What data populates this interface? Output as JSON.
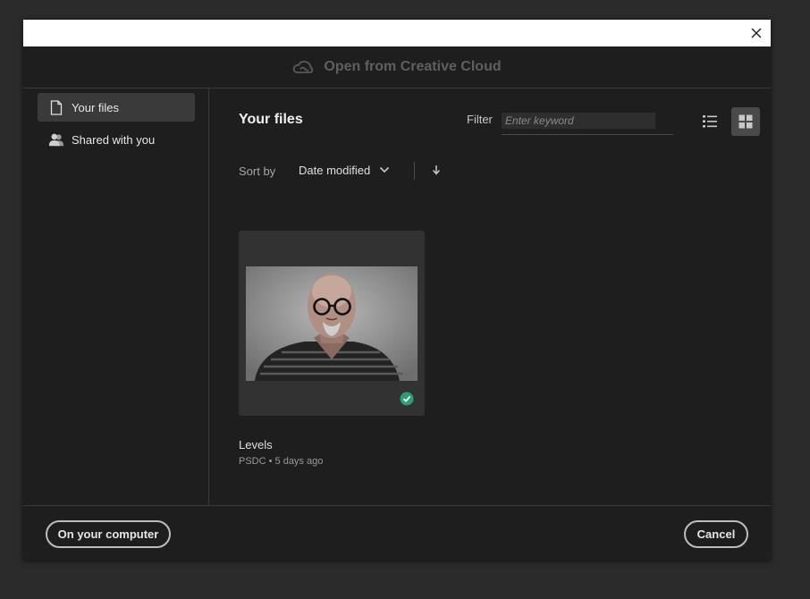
{
  "header": {
    "title": "Open from Creative Cloud",
    "logo_icon": "creative-cloud-icon"
  },
  "sidebar": {
    "items": [
      {
        "label": "Your files",
        "icon": "document-icon",
        "active": true
      },
      {
        "label": "Shared with you",
        "icon": "people-icon",
        "active": false
      }
    ]
  },
  "main": {
    "title": "Your files",
    "filter": {
      "label": "Filter",
      "placeholder": "Enter keyword",
      "value": ""
    },
    "view_modes": [
      {
        "name": "list-view",
        "icon": "list-icon",
        "active": false
      },
      {
        "name": "grid-view",
        "icon": "grid-icon",
        "active": true
      }
    ],
    "sort": {
      "label": "Sort by",
      "value": "Date modified",
      "direction_icon": "arrow-down-icon"
    },
    "files": [
      {
        "name": "Levels",
        "meta": "PSDC • 5 days ago",
        "synced": true
      }
    ]
  },
  "footer": {
    "local_button": "On your computer",
    "cancel_button": "Cancel"
  },
  "colors": {
    "background": "#1e1e1e",
    "sync_badge": "#2d9d78",
    "header_text": "#5f5f5f"
  }
}
